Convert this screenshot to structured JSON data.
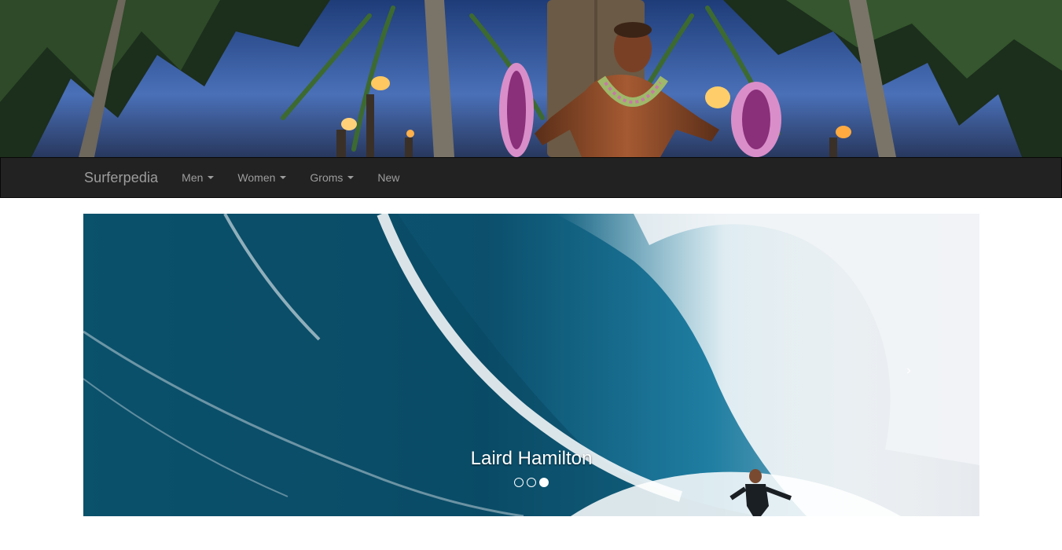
{
  "header": {
    "image_alt": "statue-banner"
  },
  "navbar": {
    "brand": "Surferpedia",
    "items": [
      {
        "label": "Men",
        "dropdown": true
      },
      {
        "label": "Women",
        "dropdown": true
      },
      {
        "label": "Groms",
        "dropdown": true
      },
      {
        "label": "New",
        "dropdown": false
      }
    ]
  },
  "carousel": {
    "caption": "Laird Hamilton",
    "next_icon": "chevron-right-icon",
    "next_glyph": "›",
    "slide_count": 3,
    "active_index": 2
  },
  "colors": {
    "navbar_bg": "#222222",
    "nav_text": "#9d9d9d",
    "caption": "#ffffff"
  }
}
